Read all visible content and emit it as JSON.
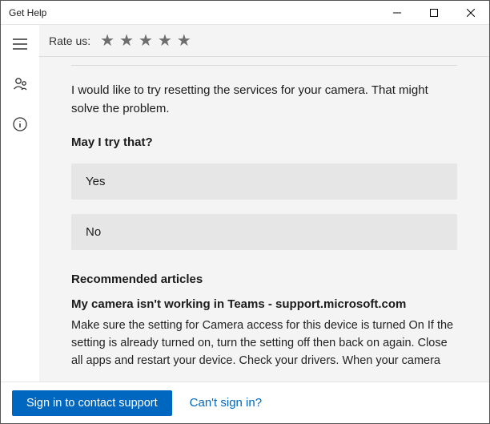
{
  "window": {
    "title": "Get Help"
  },
  "ratebar": {
    "label": "Rate us:"
  },
  "chat": {
    "message": "I would like to try resetting the services for your camera. That might solve the problem.",
    "question": "May I try that?",
    "options": {
      "yes": "Yes",
      "no": "No"
    }
  },
  "recommended": {
    "heading": "Recommended articles",
    "article": {
      "title": "My camera isn't working in Teams - support.microsoft.com",
      "body": "Make sure the setting for Camera access for this device is turned On If the setting is already turned on, turn the setting off then back on again. Close all apps and restart your device. Check your drivers. When your camera"
    }
  },
  "footer": {
    "signin": "Sign in to contact support",
    "cant": "Can't sign in?"
  }
}
